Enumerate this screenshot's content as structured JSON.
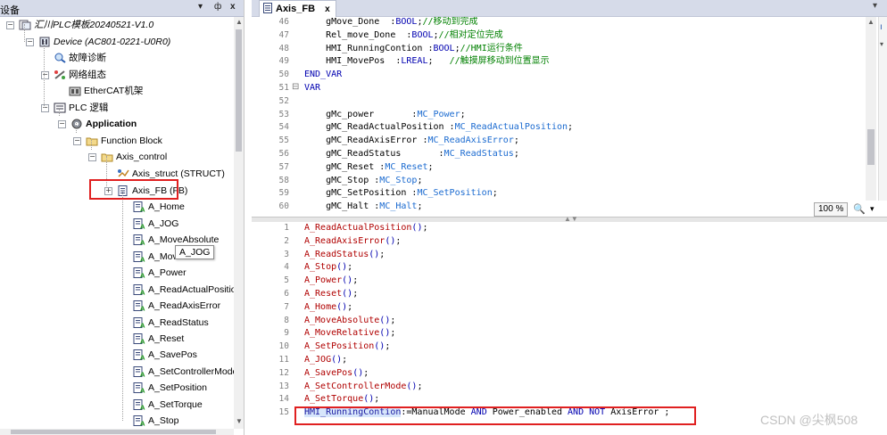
{
  "devices_panel": {
    "title": "设备",
    "pin_label": "ф",
    "close_label": "x",
    "dropdown_label": "▾"
  },
  "tree": [
    {
      "label": "汇川PLC模板20240521-V1.0",
      "icon": "project-icon"
    },
    {
      "label": "Device (AC801-0221-U0R0)",
      "icon": "device-icon"
    },
    {
      "label": "故障诊断",
      "icon": "diagnosis-icon"
    },
    {
      "label": "网络组态",
      "icon": "network-icon"
    },
    {
      "label": "EtherCAT机架",
      "icon": "ethercat-icon"
    },
    {
      "label": "PLC 逻辑",
      "icon": "plc-logic-icon"
    },
    {
      "label": "Application",
      "icon": "application-icon"
    },
    {
      "label": "Function Block",
      "icon": "folder-icon"
    },
    {
      "label": "Axis_control",
      "icon": "folder-icon"
    },
    {
      "label": "Axis_struct (STRUCT)",
      "icon": "struct-icon"
    },
    {
      "label": "Axis_FB (FB)",
      "icon": "fb-icon"
    },
    {
      "label": "A_Home",
      "icon": "action-icon"
    },
    {
      "label": "A_JOG",
      "icon": "action-icon"
    },
    {
      "label": "A_MoveAbsolute",
      "icon": "action-icon"
    },
    {
      "label": "A_MoveRe",
      "icon": "action-icon"
    },
    {
      "label": "A_Power",
      "icon": "action-icon"
    },
    {
      "label": "A_ReadActualPosition",
      "icon": "action-icon"
    },
    {
      "label": "A_ReadAxisError",
      "icon": "action-icon"
    },
    {
      "label": "A_ReadStatus",
      "icon": "action-icon"
    },
    {
      "label": "A_Reset",
      "icon": "action-icon"
    },
    {
      "label": "A_SavePos",
      "icon": "action-icon"
    },
    {
      "label": "A_SetControllerMode",
      "icon": "action-icon"
    },
    {
      "label": "A_SetPosition",
      "icon": "action-icon"
    },
    {
      "label": "A_SetTorque",
      "icon": "action-icon"
    },
    {
      "label": "A_Stop",
      "icon": "action-icon"
    }
  ],
  "tooltip": "A_JOG",
  "editor": {
    "tab_label": "Axis_FB",
    "tab_close": "x",
    "zoom": "100 %",
    "declaration_lines": [
      {
        "num": "46",
        "fold": "",
        "parts": [
          [
            "",
            "    gMove_Done  :"
          ],
          [
            "kw",
            "BOOL"
          ],
          [
            "",
            ";"
          ],
          [
            "cm",
            "//移动到完成"
          ]
        ]
      },
      {
        "num": "47",
        "fold": "",
        "parts": [
          [
            "",
            "    Rel_move_Done  :"
          ],
          [
            "kw",
            "BOOL"
          ],
          [
            "",
            ";"
          ],
          [
            "cm",
            "//相对定位完成"
          ]
        ]
      },
      {
        "num": "48",
        "fold": "",
        "parts": [
          [
            "",
            "    HMI_RunningContion :"
          ],
          [
            "kw",
            "BOOL"
          ],
          [
            "",
            ";"
          ],
          [
            "cm",
            "//HMI运行条件"
          ]
        ]
      },
      {
        "num": "49",
        "fold": "",
        "parts": [
          [
            "",
            "    HMI_MovePos  :"
          ],
          [
            "kw",
            "LREAL"
          ],
          [
            "",
            ";   "
          ],
          [
            "cm",
            "//触摸屏移动到位置显示"
          ]
        ]
      },
      {
        "num": "50",
        "fold": "",
        "parts": [
          [
            "kw",
            "END_VAR"
          ]
        ]
      },
      {
        "num": "51",
        "fold": "⊟",
        "parts": [
          [
            "kw",
            "VAR"
          ]
        ]
      },
      {
        "num": "52",
        "fold": "",
        "parts": [
          [
            "",
            ""
          ]
        ]
      },
      {
        "num": "53",
        "fold": "",
        "parts": [
          [
            "",
            "    gMc_power       :"
          ],
          [
            "ty",
            "MC_Power"
          ],
          [
            "",
            ";"
          ]
        ]
      },
      {
        "num": "54",
        "fold": "",
        "parts": [
          [
            "",
            "    gMC_ReadActualPosition :"
          ],
          [
            "ty",
            "MC_ReadActualPosition"
          ],
          [
            "",
            ";"
          ]
        ]
      },
      {
        "num": "55",
        "fold": "",
        "parts": [
          [
            "",
            "    gMC_ReadAxisError :"
          ],
          [
            "ty",
            "MC_ReadAxisError"
          ],
          [
            "",
            ";"
          ]
        ]
      },
      {
        "num": "56",
        "fold": "",
        "parts": [
          [
            "",
            "    gMC_ReadStatus       :"
          ],
          [
            "ty",
            "MC_ReadStatus"
          ],
          [
            "",
            ";"
          ]
        ]
      },
      {
        "num": "57",
        "fold": "",
        "parts": [
          [
            "",
            "    gMC_Reset :"
          ],
          [
            "ty",
            "MC_Reset"
          ],
          [
            "",
            ";"
          ]
        ]
      },
      {
        "num": "58",
        "fold": "",
        "parts": [
          [
            "",
            "    gMC_Stop :"
          ],
          [
            "ty",
            "MC_Stop"
          ],
          [
            "",
            ";"
          ]
        ]
      },
      {
        "num": "59",
        "fold": "",
        "parts": [
          [
            "",
            "    gMC_SetPosition :"
          ],
          [
            "ty",
            "MC_SetPosition"
          ],
          [
            "",
            ";"
          ]
        ]
      },
      {
        "num": "60",
        "fold": "",
        "parts": [
          [
            "",
            "    gMC_Halt :"
          ],
          [
            "ty",
            "MC_Halt"
          ],
          [
            "",
            ";"
          ]
        ]
      }
    ],
    "implementation_lines": [
      {
        "num": "1",
        "parts": [
          [
            "fn",
            "A_ReadActualPosition"
          ],
          [
            "par",
            "()"
          ],
          [
            "",
            ";"
          ]
        ]
      },
      {
        "num": "2",
        "parts": [
          [
            "fn",
            "A_ReadAxisError"
          ],
          [
            "par",
            "()"
          ],
          [
            "",
            ";"
          ]
        ]
      },
      {
        "num": "3",
        "parts": [
          [
            "fn",
            "A_ReadStatus"
          ],
          [
            "par",
            "()"
          ],
          [
            "",
            ";"
          ]
        ]
      },
      {
        "num": "4",
        "parts": [
          [
            "fn",
            "A_Stop"
          ],
          [
            "par",
            "()"
          ],
          [
            "",
            ";"
          ]
        ]
      },
      {
        "num": "5",
        "parts": [
          [
            "fn",
            "A_Power"
          ],
          [
            "par",
            "()"
          ],
          [
            "",
            ";"
          ]
        ]
      },
      {
        "num": "6",
        "parts": [
          [
            "fn",
            "A_Reset"
          ],
          [
            "par",
            "()"
          ],
          [
            "",
            ";"
          ]
        ]
      },
      {
        "num": "7",
        "parts": [
          [
            "fn",
            "A_Home"
          ],
          [
            "par",
            "()"
          ],
          [
            "",
            ";"
          ]
        ]
      },
      {
        "num": "8",
        "parts": [
          [
            "fn",
            "A_MoveAbsolute"
          ],
          [
            "par",
            "()"
          ],
          [
            "",
            ";"
          ]
        ]
      },
      {
        "num": "9",
        "parts": [
          [
            "fn",
            "A_MoveRelative"
          ],
          [
            "par",
            "()"
          ],
          [
            "",
            ";"
          ]
        ]
      },
      {
        "num": "10",
        "parts": [
          [
            "fn",
            "A_SetPosition"
          ],
          [
            "par",
            "()"
          ],
          [
            "",
            ";"
          ]
        ]
      },
      {
        "num": "11",
        "parts": [
          [
            "fn",
            "A_JOG"
          ],
          [
            "par",
            "()"
          ],
          [
            "",
            ";"
          ]
        ]
      },
      {
        "num": "12",
        "parts": [
          [
            "fn",
            "A_SavePos"
          ],
          [
            "par",
            "()"
          ],
          [
            "",
            ";"
          ]
        ]
      },
      {
        "num": "13",
        "parts": [
          [
            "fn",
            "A_SetControllerMode"
          ],
          [
            "par",
            "()"
          ],
          [
            "",
            ";"
          ]
        ]
      },
      {
        "num": "14",
        "parts": [
          [
            "fn",
            "A_SetTorque"
          ],
          [
            "par",
            "()"
          ],
          [
            "",
            ";"
          ]
        ]
      },
      {
        "num": "15",
        "parts": [
          [
            "hl",
            "HMI_RunningContion"
          ],
          [
            "",
            ":=ManualMode "
          ],
          [
            "kw",
            "AND"
          ],
          [
            "",
            " Power_enabled "
          ],
          [
            "kw",
            "AND"
          ],
          [
            "",
            " "
          ],
          [
            "kw",
            "NOT"
          ],
          [
            "",
            " AxisError ;"
          ]
        ]
      }
    ]
  },
  "watermark": "CSDN @尖枫508",
  "colors": {
    "highlight_box": "#e02020",
    "keyword": "#0000b0",
    "comment": "#008000",
    "type": "#1a6ad0",
    "function": "#b00000"
  }
}
